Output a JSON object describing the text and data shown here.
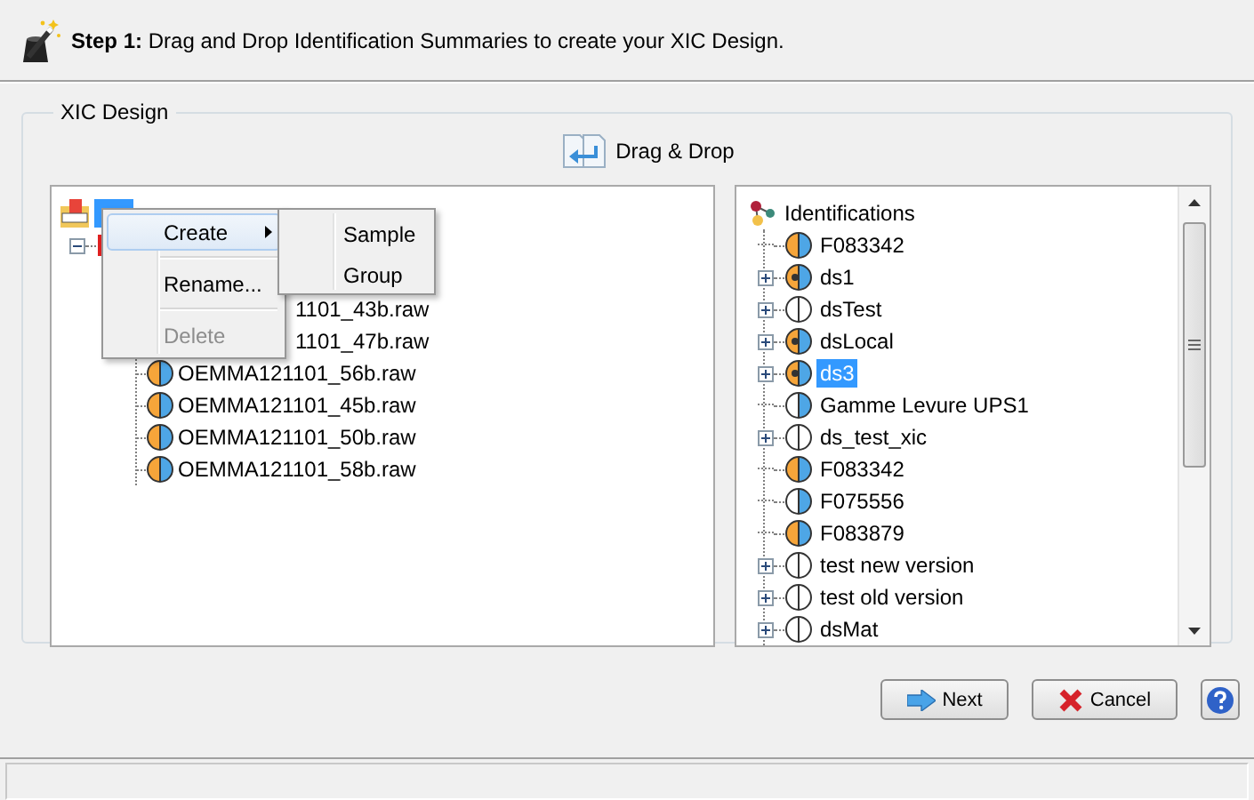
{
  "header": {
    "step": "Step 1:",
    "text": "Drag and Drop Identification Summaries to create your XIC Design."
  },
  "design_group": {
    "title": "XIC Design",
    "drag_drop": "Drag & Drop"
  },
  "design_tree": {
    "root": {
      "selected": true
    },
    "group": {
      "expanded": true
    },
    "files": [
      {
        "label": "1101_43b.raw",
        "kind": "covered"
      },
      {
        "label": "1101_47b.raw",
        "kind": "covered"
      },
      {
        "label": "OEMMA121101_56b.raw",
        "kind": "file"
      },
      {
        "label": "OEMMA121101_45b.raw",
        "kind": "file"
      },
      {
        "label": "OEMMA121101_50b.raw",
        "kind": "file"
      },
      {
        "label": "OEMMA121101_58b.raw",
        "kind": "file"
      }
    ]
  },
  "context_menu": {
    "items": [
      {
        "kind": "item",
        "label": "Create",
        "selected": true,
        "disabled": false,
        "submenu": true
      },
      {
        "kind": "separator"
      },
      {
        "kind": "item",
        "label": "Rename...",
        "selected": false,
        "disabled": false,
        "submenu": false
      },
      {
        "kind": "separator"
      },
      {
        "kind": "item",
        "label": "Delete",
        "selected": false,
        "disabled": true,
        "submenu": false
      }
    ],
    "submenu": [
      "Sample",
      "Group"
    ]
  },
  "identifications": {
    "label": "Identifications",
    "items": [
      {
        "label": "F083342",
        "kind": "full",
        "selected": false
      },
      {
        "label": "ds1",
        "kind": "merged",
        "expanded": false,
        "selected": false
      },
      {
        "label": "dsTest",
        "kind": "empty",
        "expanded": false,
        "selected": false
      },
      {
        "label": "dsLocal",
        "kind": "merged",
        "expanded": false,
        "selected": false
      },
      {
        "label": "ds3",
        "kind": "merged",
        "expanded": false,
        "selected": true
      },
      {
        "label": "Gamme Levure UPS1",
        "kind": "partial",
        "selected": false
      },
      {
        "label": "ds_test_xic",
        "kind": "empty",
        "expanded": false,
        "selected": false
      },
      {
        "label": "F083342",
        "kind": "full",
        "selected": false
      },
      {
        "label": "F075556",
        "kind": "partial",
        "selected": false
      },
      {
        "label": "F083879",
        "kind": "full",
        "selected": false
      },
      {
        "label": "test new version",
        "kind": "empty",
        "expanded": false,
        "selected": false
      },
      {
        "label": "test old version",
        "kind": "empty",
        "expanded": false,
        "selected": false
      },
      {
        "label": "dsMat",
        "kind": "empty",
        "expanded": false,
        "selected": false
      }
    ]
  },
  "buttons": [
    {
      "kind": "next",
      "label": "Next"
    },
    {
      "kind": "cancel",
      "label": "Cancel"
    },
    {
      "kind": "help"
    }
  ]
}
